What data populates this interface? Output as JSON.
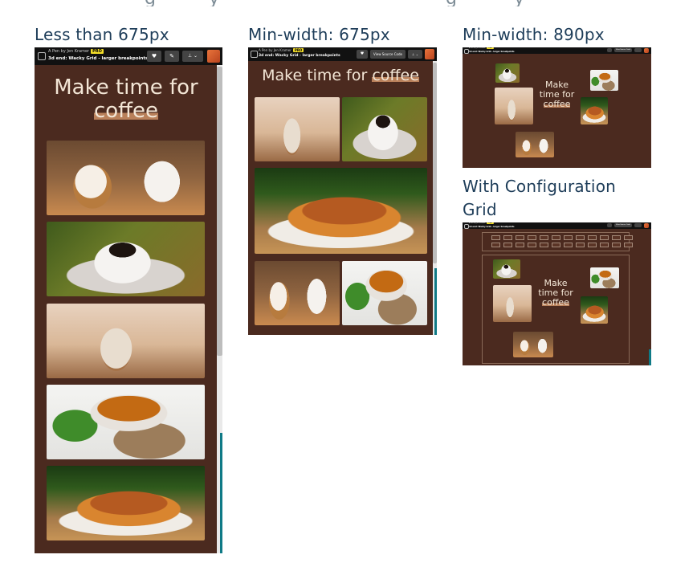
{
  "columns": {
    "mobile": {
      "title": "Less than 675px"
    },
    "tablet": {
      "title": "Min-width: 675px"
    },
    "desktop": {
      "title": "Min-width: 890px"
    },
    "config": {
      "title_line1": "With Configuration",
      "title_line2": "Grid"
    }
  },
  "codepen": {
    "byline": "A Pen by Jen Kramer",
    "pro_badge": "PRO",
    "pen_title": "3d end: Wacky Grid - larger breakpoints",
    "view_source_label": "View Source Code"
  },
  "page": {
    "heading_prefix": "Make time for",
    "heading_highlight": "coffee"
  },
  "photos": [
    "latte-and-mug",
    "espresso-cup",
    "iced-coffee-jar",
    "tea-cup-mint",
    "croissant"
  ],
  "colors": {
    "page_background": "#4b2a1f",
    "heading": "#f3e6d6",
    "highlight": "#b9805a",
    "header_bar": "#111111",
    "pro_badge": "#f5df29",
    "column_title": "#1e3d59"
  }
}
